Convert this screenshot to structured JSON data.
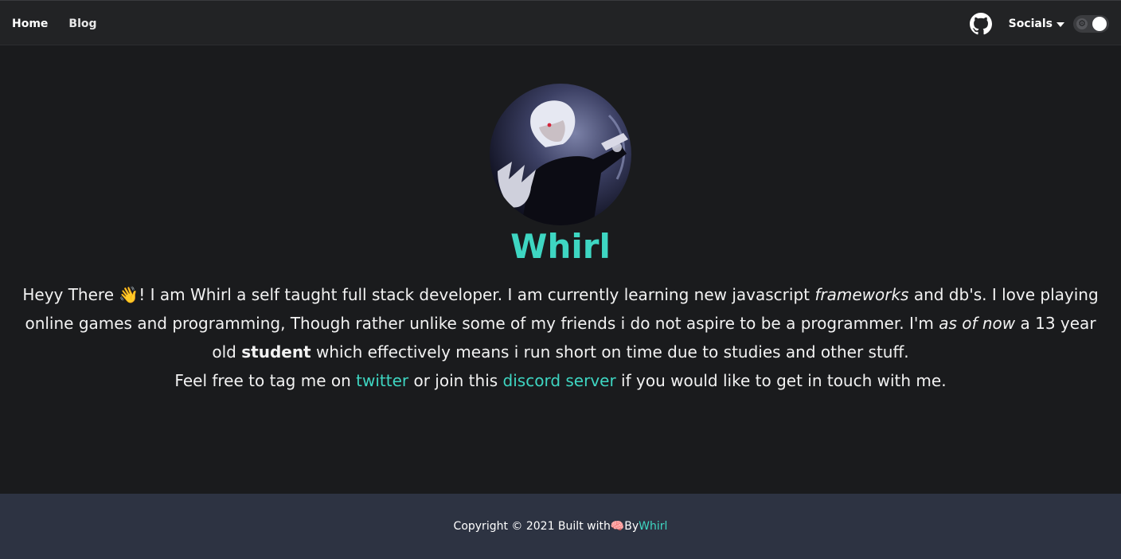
{
  "nav": {
    "links": [
      {
        "label": "Home"
      },
      {
        "label": "Blog"
      }
    ],
    "socials_label": "Socials",
    "github_icon": "github-icon",
    "theme_toggle_icon": "gear-icon"
  },
  "profile": {
    "name": "Whirl",
    "avatar_icon": "avatar-image"
  },
  "bio": {
    "p1": "Heyy There ",
    "emoji_wave": "👋",
    "p2": "! I am Whirl a self taught full stack developer. I am currently learning new javascript ",
    "em_frameworks": "frameworks",
    "p3": " and db's. I love playing online games and programming, Though rather unlike some of my friends i do not aspire to be a programmer. I'm ",
    "em_as_of_now": "as of now",
    "p4": " a 13 year old ",
    "strong_student": "student",
    "p5": " which effectively means i run short on time due to studies and other stuff.",
    "p6": "Feel free to tag me on ",
    "link_twitter": "twitter",
    "p7": " or join this ",
    "link_discord": "discord server",
    "p8": " if you would like to get in touch with me."
  },
  "footer": {
    "text1": "Copyright © 2021 Built with ",
    "emoji_brain": "🧠",
    "text2": " By ",
    "link_whirl": "Whirl"
  },
  "colors": {
    "accent": "#3ed6c2",
    "background": "#1a1b1d",
    "nav_background": "#222325",
    "footer_background": "#2d3342"
  }
}
